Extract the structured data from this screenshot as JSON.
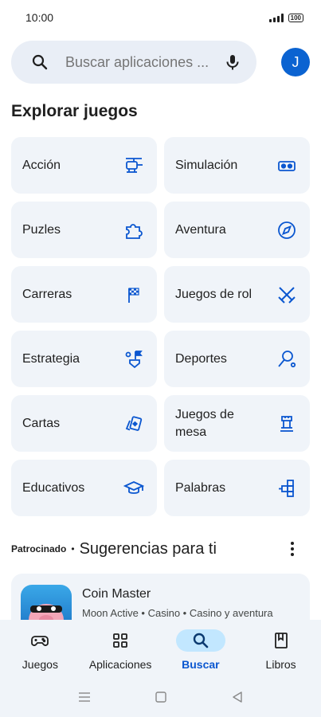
{
  "status_bar": {
    "time": "10:00",
    "battery": "100"
  },
  "search": {
    "placeholder": "Buscar aplicaciones ...",
    "avatar_letter": "J"
  },
  "section_title": "Explorar juegos",
  "categories": [
    {
      "label": "Acción",
      "icon": "helicopter-icon"
    },
    {
      "label": "Simulación",
      "icon": "vr-headset-icon"
    },
    {
      "label": "Puzles",
      "icon": "puzzle-icon"
    },
    {
      "label": "Aventura",
      "icon": "compass-icon"
    },
    {
      "label": "Carreras",
      "icon": "checkered-flag-icon"
    },
    {
      "label": "Juegos de rol",
      "icon": "crossed-swords-icon"
    },
    {
      "label": "Estrategia",
      "icon": "strategy-flag-icon"
    },
    {
      "label": "Deportes",
      "icon": "racket-icon"
    },
    {
      "label": "Cartas",
      "icon": "cards-icon"
    },
    {
      "label": "Juegos de mesa",
      "icon": "chess-rook-icon"
    },
    {
      "label": "Educativos",
      "icon": "graduation-cap-icon"
    },
    {
      "label": "Palabras",
      "icon": "word-blocks-icon"
    }
  ],
  "sponsored": {
    "tag": "Patrocinado",
    "separator": "•",
    "title": "Sugerencias para ti"
  },
  "app": {
    "name": "Coin Master",
    "meta": "Moon Active • Casino • Casino y aventura"
  },
  "bottom_nav": [
    {
      "label": "Juegos",
      "icon": "gamepad-icon",
      "active": false
    },
    {
      "label": "Aplicaciones",
      "icon": "apps-grid-icon",
      "active": false
    },
    {
      "label": "Buscar",
      "icon": "search-icon",
      "active": true
    },
    {
      "label": "Libros",
      "icon": "bookmark-book-icon",
      "active": false
    }
  ],
  "colors": {
    "accent": "#0b57d0",
    "tile_bg": "#f0f4f9",
    "search_bg": "#e9eef6",
    "active_pill": "#c2e7ff"
  }
}
